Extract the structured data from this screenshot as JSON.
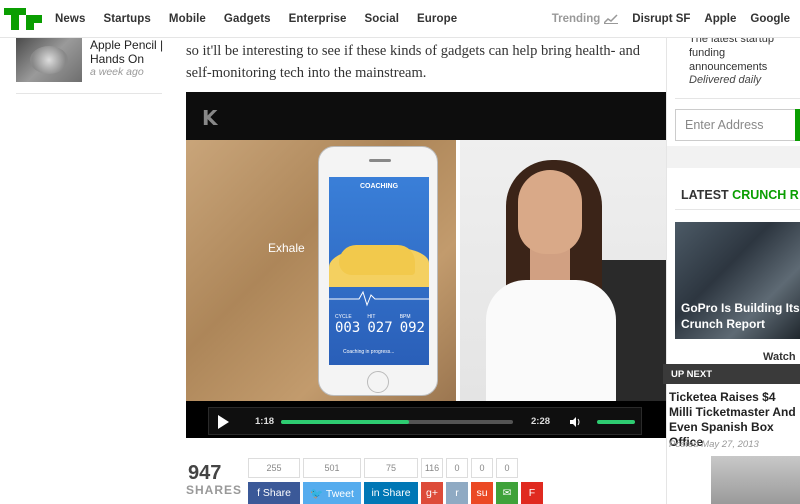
{
  "nav": {
    "items": [
      "News",
      "Startups",
      "Mobile",
      "Gadgets",
      "Enterprise",
      "Social",
      "Europe"
    ],
    "trending_label": "Trending",
    "right_items": [
      "Disrupt SF",
      "Apple",
      "Google"
    ]
  },
  "sidebar": {
    "story_title": "Apple Pencil | Hands On",
    "story_time": "a week ago"
  },
  "article": {
    "text": "so it'll be interesting to see if these kinds of gadgets can help bring health- and self-monitoring tech into the mainstream."
  },
  "video": {
    "brand_logo": "K",
    "exhale_label": "Exhale",
    "app_title": "COACHING",
    "cycle_label": "CYCLE",
    "cycle_value": "003",
    "hit_label": "HIT",
    "hit_value": "027",
    "bpm_label": "BPM",
    "bpm_value": "092",
    "status": "Coaching in progress...",
    "current_time": "1:18",
    "duration": "2:28",
    "progress": 0.55
  },
  "share": {
    "count": "947",
    "label": "SHARES",
    "counts": [
      "255",
      "501",
      "75",
      "116",
      "0",
      "0",
      "0"
    ],
    "buttons": [
      {
        "label": "f Share",
        "color": "#3b5998",
        "width": 52
      },
      {
        "label": "🐦 Tweet",
        "color": "#55acee",
        "width": 58
      },
      {
        "label": "in Share",
        "color": "#0077b5",
        "width": 54
      },
      {
        "label": "g+",
        "color": "#dd4b39",
        "width": 22
      },
      {
        "label": "r",
        "color": "#8faac3",
        "width": 22
      },
      {
        "label": "su",
        "color": "#eb4924",
        "width": 22
      },
      {
        "label": "✉",
        "color": "#3fa23a",
        "width": 22
      },
      {
        "label": "F",
        "color": "#e02a20",
        "width": 22
      }
    ]
  },
  "newsletter": {
    "text": "The latest startup funding announcements",
    "sub": "Delivered daily",
    "placeholder": "Enter Address"
  },
  "latest": {
    "heading_a": "LATEST",
    "heading_b": "CRUNCH R",
    "feature_title": "GoPro Is Building Its Crunch Report",
    "watch_label": "Watch"
  },
  "up_next": {
    "label": "UP NEXT",
    "title": "Ticketea Raises $4 Milli Ticketmaster And Even Spanish Box Office",
    "date": "Posted May 27, 2013"
  },
  "colors": {
    "brand_green": "#0a9e01",
    "progress_green": "#2ecc71"
  }
}
